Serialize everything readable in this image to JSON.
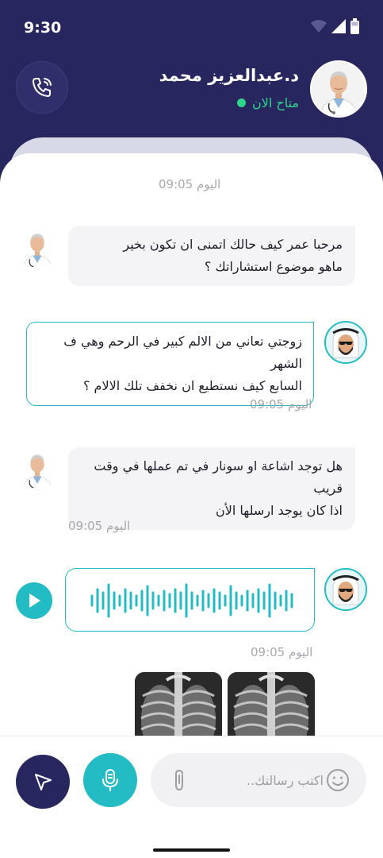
{
  "status_bar": {
    "time": "9:30"
  },
  "header": {
    "doctor_name": "د.عبدالعزيز محمد",
    "status": "متاح الان",
    "status_color": "#2fd58a",
    "brand_color": "#27265f",
    "accent_color": "#23bcc5"
  },
  "messages": [
    {
      "time": "اليوم 09:05"
    },
    {
      "sender": "doctor",
      "lines": [
        "مرحبا عمر كيف حالك اتمنى ان تكون بخير",
        "ماهو موضوع استشاراتك ؟"
      ]
    },
    {
      "sender": "patient",
      "lines": [
        "زوجتي تعاني من الالم كبير في الرحم وهي ف الشهر",
        "السابع كيف نستطيع ان نخفف تلك الالام ؟"
      ],
      "time": "اليوم 09:05"
    },
    {
      "sender": "doctor",
      "lines": [
        "هل توجد اشاعة او سونار في تم عملها في وقت قريب",
        "اذا كان يوجد ارسلها الأن"
      ],
      "time": "اليوم 09:05"
    },
    {
      "sender": "patient",
      "type": "voice",
      "time": "اليوم 09:05"
    },
    {
      "sender": "patient",
      "type": "images",
      "count": 2
    }
  ],
  "composer": {
    "placeholder": "اكتب رسالتك.."
  }
}
